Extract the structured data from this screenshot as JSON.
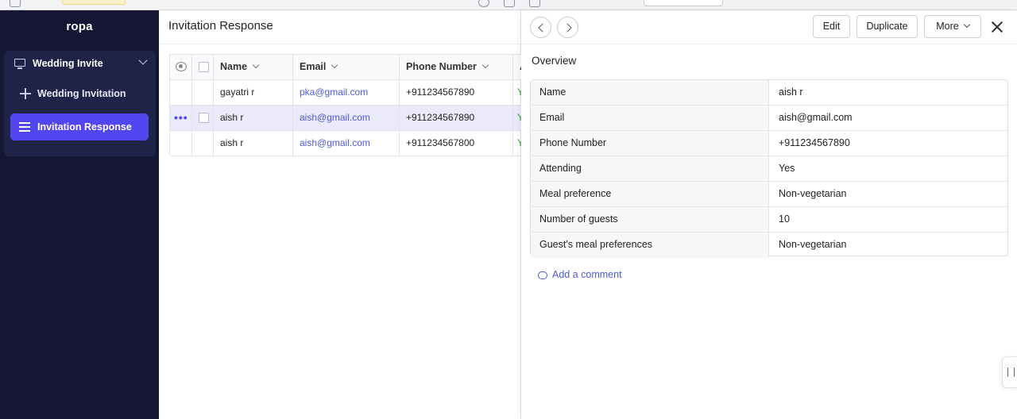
{
  "sidebar": {
    "brand": "ropa",
    "group": {
      "label": "Wedding Invite"
    },
    "items": [
      {
        "label": "Wedding Invitation",
        "active": false
      },
      {
        "label": "Invitation Response",
        "active": true
      }
    ]
  },
  "main": {
    "title": "Invitation Response",
    "columns": [
      "Name",
      "Email",
      "Phone Number",
      "A"
    ],
    "rows": [
      {
        "name": "gayatri r",
        "email": "pka@gmail.com",
        "phone": "+911234567890",
        "attending": "Ye"
      },
      {
        "name": "aish r",
        "email": "aish@gmail.com",
        "phone": "+911234567890",
        "attending": "Ye"
      },
      {
        "name": "aish r",
        "email": "aish@gmail.com",
        "phone": "+911234567800",
        "attending": "Ye"
      }
    ]
  },
  "detail": {
    "buttons": {
      "edit": "Edit",
      "duplicate": "Duplicate",
      "more": "More"
    },
    "section_title": "Overview",
    "fields": [
      {
        "label": "Name",
        "value": "aish r",
        "type": "text"
      },
      {
        "label": "Email",
        "value": "aish@gmail.com",
        "type": "link"
      },
      {
        "label": "Phone Number",
        "value": "+911234567890",
        "type": "text"
      },
      {
        "label": "Attending",
        "value": "Yes",
        "type": "yes"
      },
      {
        "label": "Meal preference",
        "value": "Non-vegetarian",
        "type": "text"
      },
      {
        "label": "Number of guests",
        "value": "10",
        "type": "text"
      },
      {
        "label": "Guest's meal preferences",
        "value": "Non-vegetarian",
        "type": "text"
      }
    ],
    "add_comment": "Add a comment"
  },
  "colors": {
    "sidebar_bg": "#141633",
    "accent": "#5246f0",
    "link": "#4b5bd8",
    "yes": "#33a133"
  }
}
